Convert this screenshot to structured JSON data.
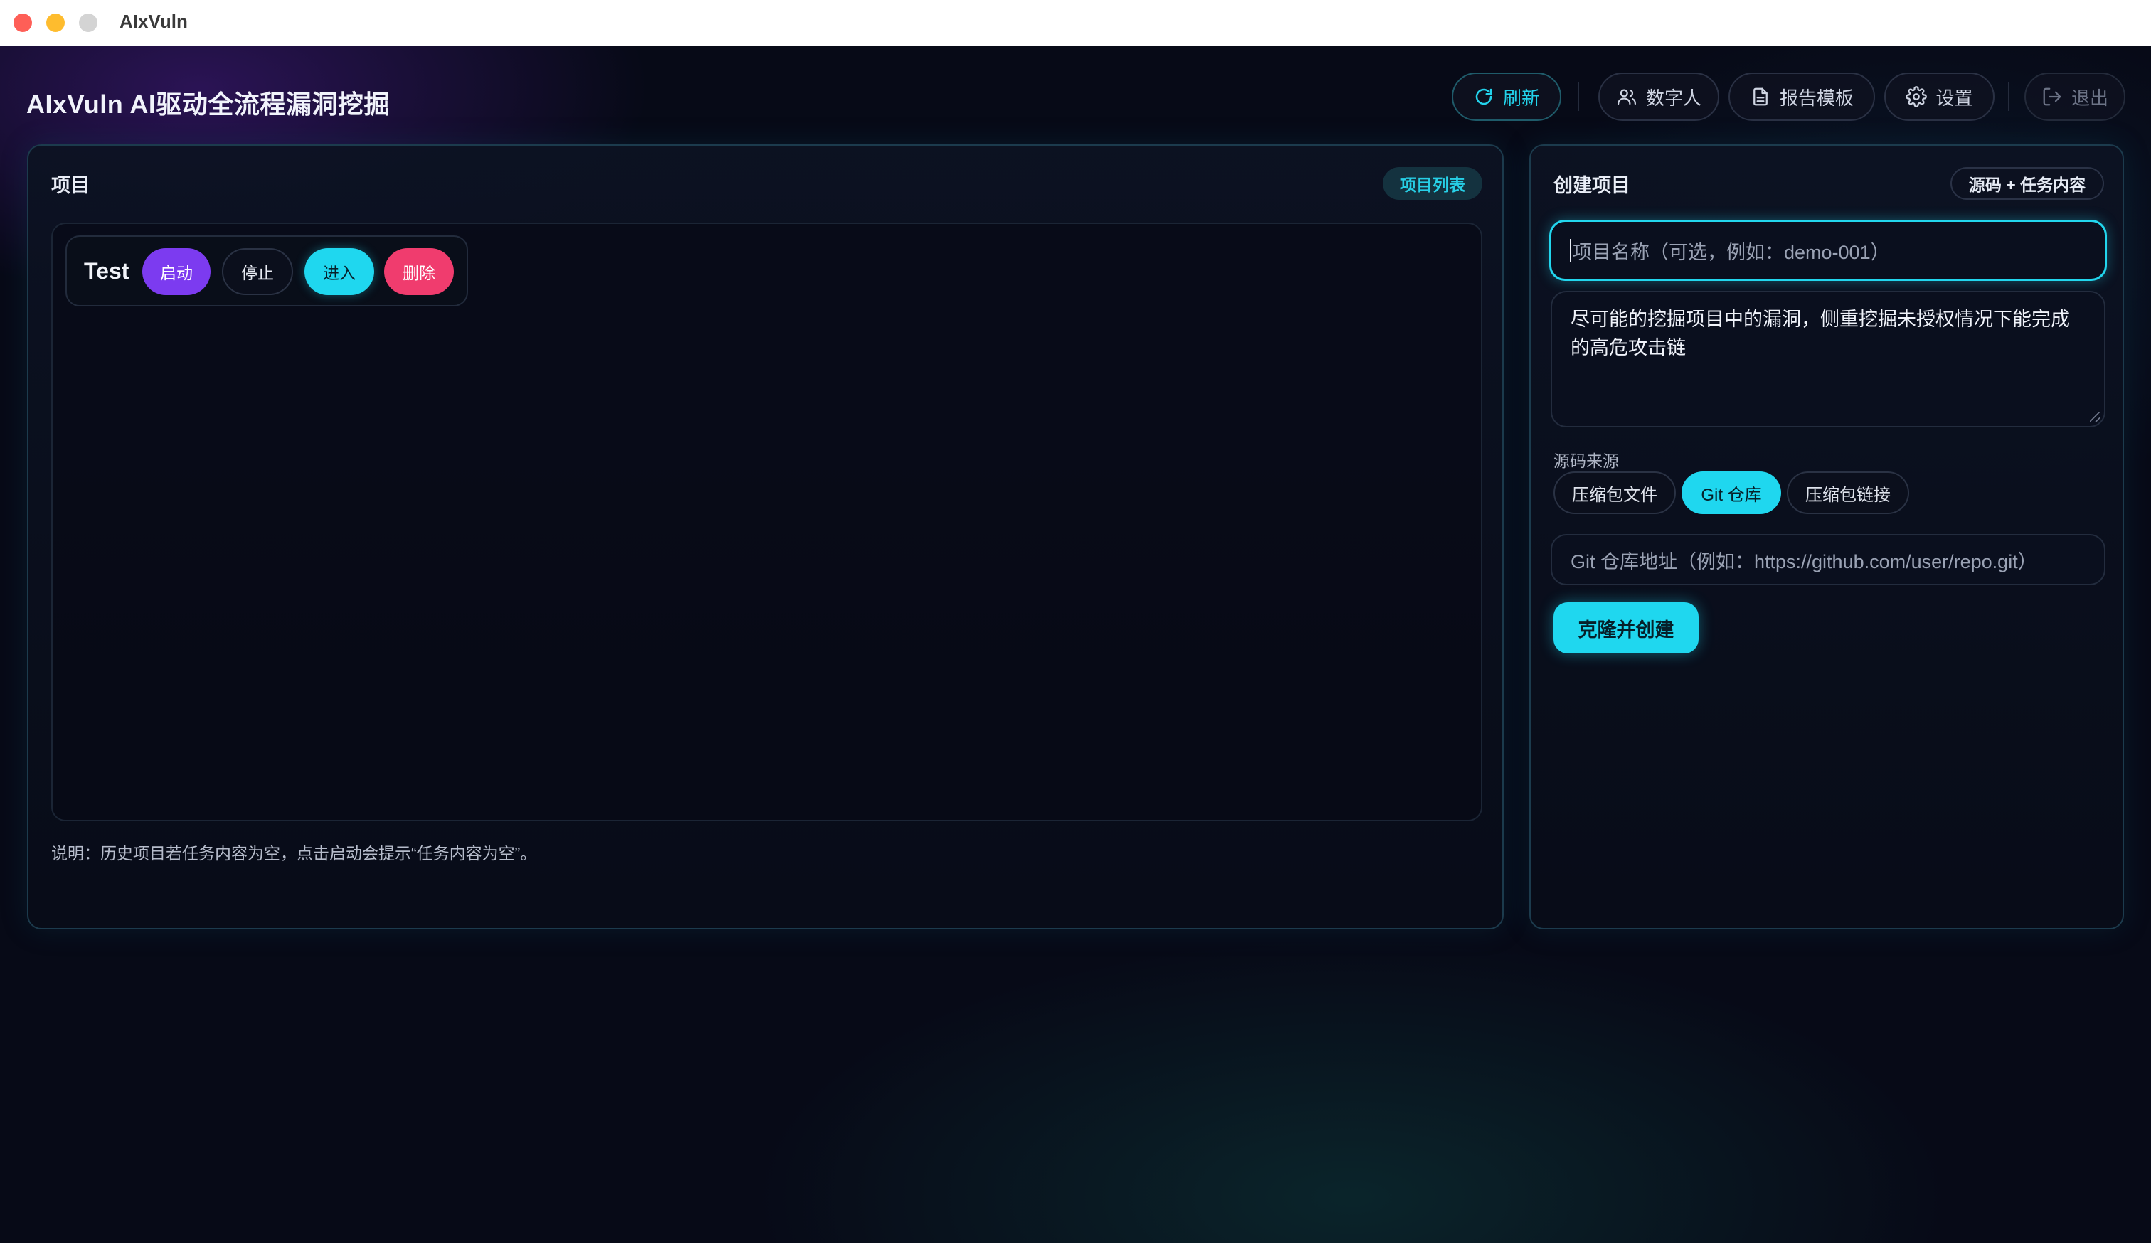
{
  "window": {
    "title": "AIxVuln"
  },
  "header": {
    "app_title": "AIxVuln AI驱动全流程漏洞挖掘",
    "buttons": {
      "refresh": "刷新",
      "digital_human": "数字人",
      "report_template": "报告模板",
      "settings": "设置",
      "logout": "退出"
    },
    "icons": {
      "refresh": "refresh-icon",
      "digital_human": "users-icon",
      "report_template": "document-icon",
      "settings": "gear-icon",
      "logout": "logout-icon"
    }
  },
  "projects_panel": {
    "title": "项目",
    "badge": "项目列表",
    "items": [
      {
        "name": "Test",
        "actions": {
          "start": "启动",
          "stop": "停止",
          "enter": "进入",
          "delete": "删除"
        }
      }
    ],
    "note": "说明：历史项目若任务内容为空，点击启动会提示“任务内容为空”。"
  },
  "create_panel": {
    "title": "创建项目",
    "badge": "源码 + 任务内容",
    "name_input": {
      "value": "",
      "placeholder": "项目名称（可选，例如：demo-001）"
    },
    "task_textarea": {
      "value": "尽可能的挖掘项目中的漏洞，侧重挖掘未授权情况下能完成的高危攻击链"
    },
    "source_label": "源码来源",
    "source_options": [
      "压缩包文件",
      "Git 仓库",
      "压缩包链接"
    ],
    "source_selected": "Git 仓库",
    "repo_input": {
      "value": "",
      "placeholder": "Git 仓库地址（例如：https://github.com/user/repo.git）"
    },
    "submit_label": "克隆并创建"
  },
  "colors": {
    "accent_cyan": "#1fd7ef",
    "start_purple": "#7c3bf0",
    "delete_pink": "#f03c6e",
    "background": "#070a17"
  }
}
